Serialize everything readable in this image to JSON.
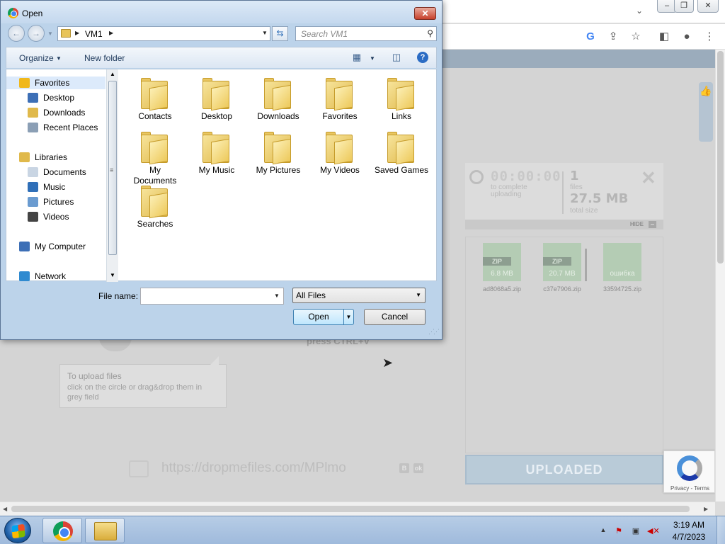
{
  "dialog": {
    "title": "Open",
    "close_glyph": "✕",
    "address": {
      "path": "VM1"
    },
    "search": {
      "placeholder": "Search VM1"
    },
    "commands": {
      "organize": "Organize",
      "new_folder": "New folder"
    },
    "nav": [
      {
        "label": "Favorites",
        "icon": "star-icon",
        "group": true
      },
      {
        "label": "Desktop",
        "icon": "desktop-icon"
      },
      {
        "label": "Downloads",
        "icon": "downloads-folder-icon"
      },
      {
        "label": "Recent Places",
        "icon": "recent-places-icon"
      },
      {
        "label": "Libraries",
        "icon": "libraries-icon",
        "group": true
      },
      {
        "label": "Documents",
        "icon": "documents-icon"
      },
      {
        "label": "Music",
        "icon": "music-icon"
      },
      {
        "label": "Pictures",
        "icon": "pictures-icon"
      },
      {
        "label": "Videos",
        "icon": "videos-icon"
      },
      {
        "label": "My Computer",
        "icon": "computer-icon",
        "group": true
      },
      {
        "label": "Network",
        "icon": "network-icon",
        "group": true
      }
    ],
    "folders": [
      {
        "label": "Contacts",
        "icon": "contacts-folder-icon",
        "glyph": "▤"
      },
      {
        "label": "Desktop",
        "icon": "desktop-folder-icon",
        "glyph": "▭"
      },
      {
        "label": "Downloads",
        "icon": "downloads-folder-icon",
        "glyph": "⬇"
      },
      {
        "label": "Favorites",
        "icon": "favorites-folder-icon",
        "glyph": "★"
      },
      {
        "label": "Links",
        "icon": "links-folder-icon",
        "glyph": "↗"
      },
      {
        "label": "My Documents",
        "icon": "documents-folder-icon",
        "glyph": "▥"
      },
      {
        "label": "My Music",
        "icon": "music-folder-icon",
        "glyph": "♪"
      },
      {
        "label": "My Pictures",
        "icon": "pictures-folder-icon",
        "glyph": "▨"
      },
      {
        "label": "My Videos",
        "icon": "videos-folder-icon",
        "glyph": "▶"
      },
      {
        "label": "Saved Games",
        "icon": "saved-games-folder-icon",
        "glyph": "♠"
      },
      {
        "label": "Searches",
        "icon": "searches-folder-icon",
        "glyph": "⚲"
      }
    ],
    "file_name_label": "File name:",
    "file_name_value": "",
    "file_type": "All Files",
    "open_label": "Open",
    "cancel_label": "Cancel"
  },
  "site": {
    "status": {
      "time": "00:00:00",
      "time_sub1": "to complete",
      "time_sub2": "uploading",
      "files_count": "1",
      "files_label": "files",
      "total_size": "27.5 MB",
      "total_label": "total size"
    },
    "hide_label": "HIDE",
    "files": [
      {
        "badge": "ZIP",
        "size": "6.8 MB",
        "name": "ad8068a5.zip"
      },
      {
        "badge": "ZIP",
        "size": "20.7 MB",
        "name": "c37e7906.zip"
      },
      {
        "badge": "",
        "size": "ошибка",
        "name": "33594725.zip"
      }
    ],
    "uploaded_label": "UPLOADED",
    "paste_hint": "press CTRL+V",
    "tip_title": "To upload files",
    "tip_text": "click on the circle or drag&drop them in grey field",
    "share_url": "https://dropmefiles.com/MPlmo",
    "share_b1": "B",
    "share_b2": "ok",
    "recaptcha_links": "Privacy - Terms"
  },
  "taskbar": {
    "time": "3:19 AM",
    "date": "4/7/2023"
  },
  "colors": {
    "dialog_frame": "#bcd3ea",
    "close_red": "#c7402b",
    "uploaded_bg": "#b9cbd8",
    "taskbar": "#a8c2e0"
  }
}
